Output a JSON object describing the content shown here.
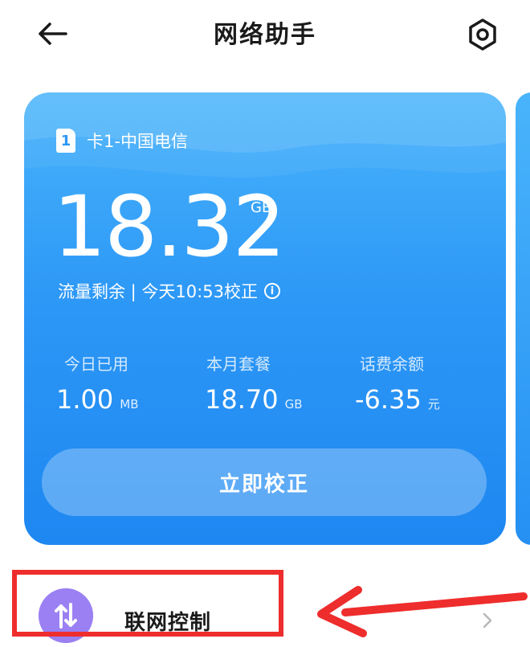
{
  "header": {
    "title": "网络助手",
    "back_icon": "arrow-left-icon",
    "settings_icon": "settings-hexagon-icon"
  },
  "card": {
    "sim_number": "1",
    "sim_label": "卡1-中国电信",
    "remaining_value": "18.32",
    "remaining_unit": "GB",
    "remaining_caption": "流量剩余 | 今天10:53校正",
    "info_icon": "i",
    "stats": [
      {
        "label": "今日已用",
        "value": "1.00",
        "unit": "MB"
      },
      {
        "label": "本月套餐",
        "value": "18.70",
        "unit": "GB"
      },
      {
        "label": "话费余额",
        "value": "-6.35",
        "unit": "元"
      }
    ],
    "calibrate_button": "立即校正"
  },
  "network_control": {
    "label": "联网控制",
    "icon": "up-down-arrows-icon"
  },
  "colors": {
    "card_top": "#49b4fb",
    "card_bottom": "#1e87f1",
    "highlight": "#ee2d2d",
    "net_icon": "#8d6ff0"
  }
}
